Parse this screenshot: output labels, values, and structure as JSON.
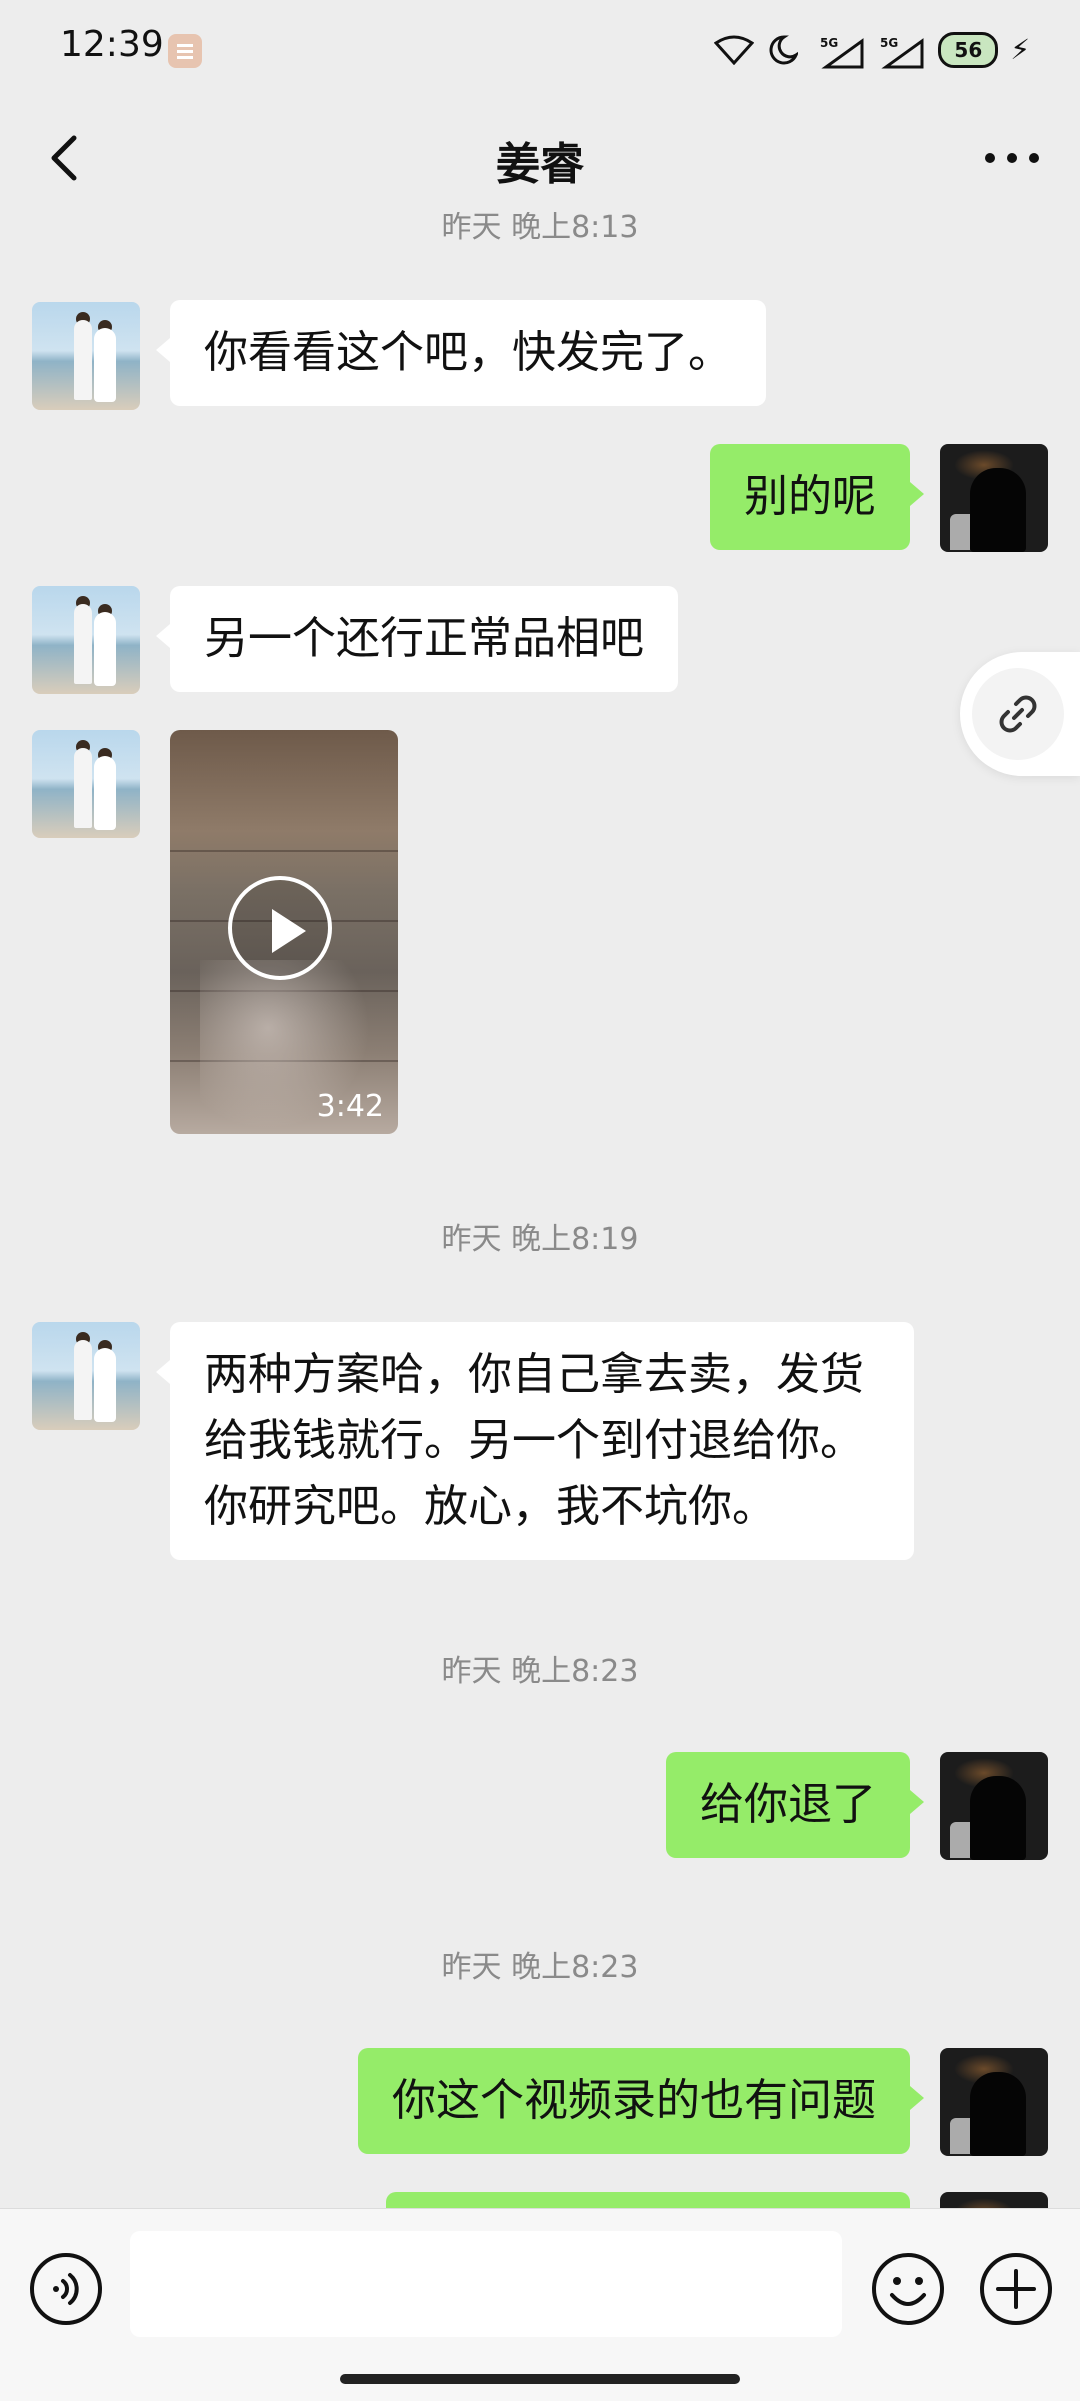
{
  "status_bar": {
    "time": "12:39",
    "battery": "56",
    "network_1": "5G",
    "network_2": "5G"
  },
  "header": {
    "title": "姜睿",
    "back_icon": "chevron-left-icon",
    "more_icon": "more-horizontal-icon"
  },
  "chat": {
    "top_timestamp_partial": "昨天 晚上8:13",
    "msg1": "你看看这个吧，快发完了。",
    "msg2": "别的呢",
    "msg3": "另一个还行正常品相吧",
    "video_duration": "3:42",
    "ts1": "昨天 晚上8:19",
    "msg4_line1": "两种方案哈，你自己拿去卖，发货",
    "msg4_line2": "给我钱就行。另一个到付退给你。",
    "msg4_line3": "你研究吧。放心，我不坑你。",
    "ts2": "昨天 晚上8:23",
    "msg5": "给你退了",
    "ts3": "昨天 晚上8:23",
    "msg6": "你这个视频录的也有问题"
  },
  "input_bar": {
    "text_value": "",
    "voice_icon": "voice-icon",
    "emoji_icon": "emoji-icon",
    "plus_icon": "plus-icon"
  },
  "floating": {
    "link_icon": "link-icon"
  },
  "colors": {
    "background": "#ededed",
    "outgoing_bubble": "#95ec69",
    "incoming_bubble": "#ffffff",
    "timestamp": "#8a8a8a"
  }
}
